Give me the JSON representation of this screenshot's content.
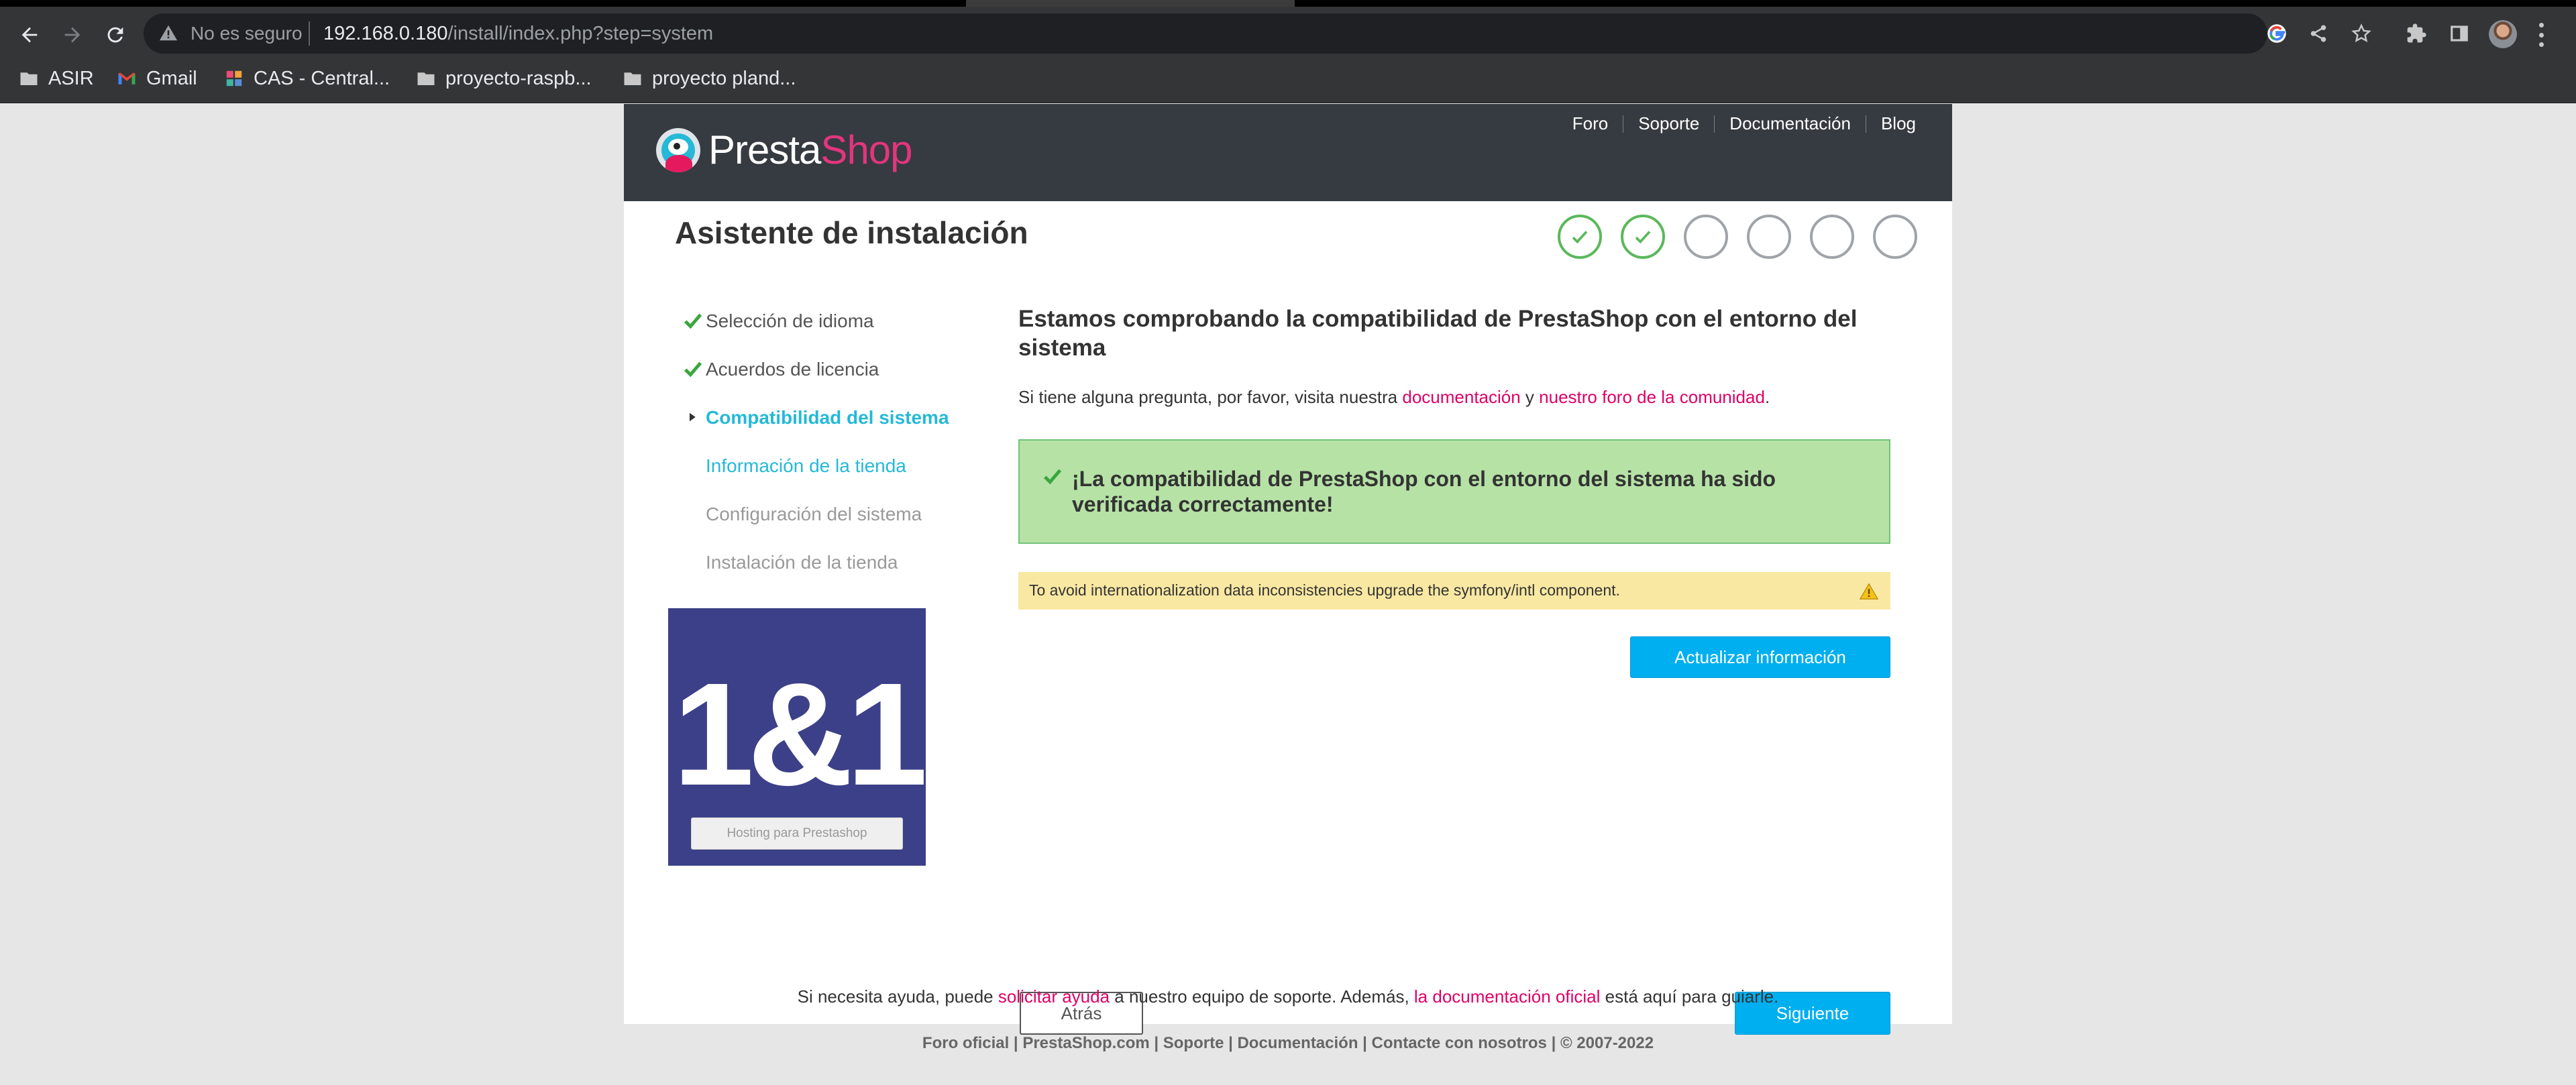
{
  "browser": {
    "security_label": "No es seguro",
    "url_host": "192.168.0.180",
    "url_path": "/install/index.php?step=system",
    "bookmarks": [
      {
        "label": "ASIR",
        "icon": "folder-icon"
      },
      {
        "label": "Gmail",
        "icon": "gmail-icon"
      },
      {
        "label": "CAS - Central...",
        "icon": "cas-icon"
      },
      {
        "label": "proyecto-raspb...",
        "icon": "folder-icon"
      },
      {
        "label": "proyecto pland...",
        "icon": "folder-icon"
      }
    ]
  },
  "header": {
    "logo_presta": "Presta",
    "logo_shop": "Shop",
    "links": [
      "Foro",
      "Soporte",
      "Documentación",
      "Blog"
    ]
  },
  "wizard": {
    "title": "Asistente de instalación",
    "steps_done": 2,
    "steps_total": 6
  },
  "sidebar": {
    "items": [
      {
        "label": "Selección de idioma",
        "state": "done"
      },
      {
        "label": "Acuerdos de licencia",
        "state": "done"
      },
      {
        "label": "Compatibilidad del sistema",
        "state": "active"
      },
      {
        "label": "Información de la tienda",
        "state": "next"
      },
      {
        "label": "Configuración del sistema",
        "state": "future"
      },
      {
        "label": "Instalación de la tienda",
        "state": "future"
      }
    ],
    "promo_brand": "1&1",
    "promo_button": "Hosting para Prestashop"
  },
  "main": {
    "heading": "Estamos comprobando la compatibilidad de PrestaShop con el entorno del sistema",
    "intro_prefix": "Si tiene alguna pregunta, por favor, visita nuestra ",
    "intro_link1": "documentación",
    "intro_mid": " y ",
    "intro_link2": "nuestro foro de la comunidad",
    "intro_suffix": ".",
    "success_message": "¡La compatibilidad de PrestaShop con el entorno del sistema ha sido verificada correctamente!",
    "warning_message": "To avoid internationalization data inconsistencies upgrade the symfony/intl component.",
    "refresh_button": "Actualizar información",
    "back_button": "Atrás",
    "next_button": "Siguiente"
  },
  "footer": {
    "help_prefix": "Si necesita ayuda, puede ",
    "help_link1": "solicitar ayuda",
    "help_mid": " a nuestro equipo de soporte. Además, ",
    "help_link2": "la documentación oficial",
    "help_suffix": " está aquí para guiarle.",
    "links_line": "Foro oficial | PrestaShop.com | Soporte | Documentación | Contacte con nosotros | © 2007-2022"
  },
  "colors": {
    "header_bg": "#363a41",
    "accent_blue": "#00aff0",
    "link_pink": "#df0067",
    "success_bg": "#b6e2a6",
    "warning_bg": "#f9e8a2",
    "done_green": "#5cb85c"
  }
}
